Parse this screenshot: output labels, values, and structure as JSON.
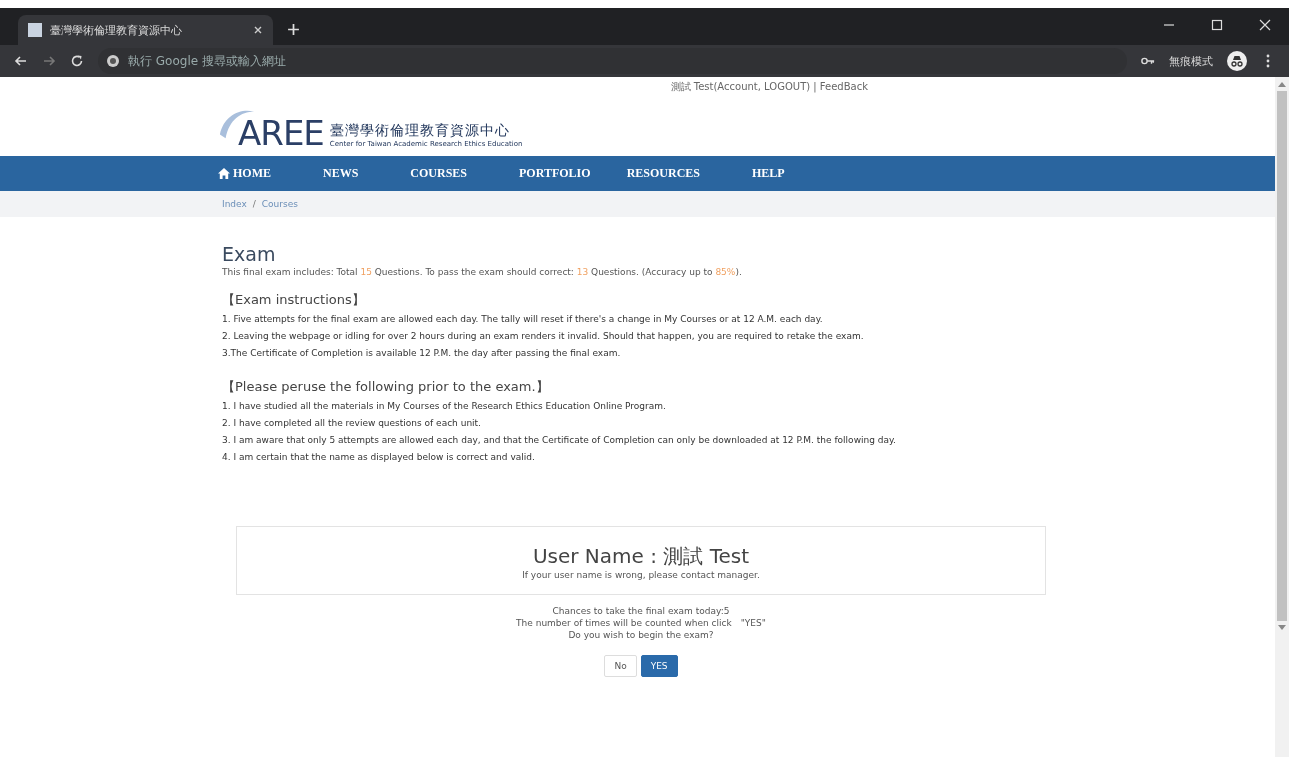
{
  "browser": {
    "tab_title": "臺灣學術倫理教育資源中心",
    "address_placeholder": "執行 Google 搜尋或輸入網址",
    "profile_label": "無痕模式"
  },
  "header": {
    "account_line": "測試 Test(Account, LOGOUT) | FeedBack",
    "logo_text": "AREE",
    "site_name": "臺灣學術倫理教育資源中心",
    "site_subtitle": "Center for Taiwan Academic Research Ethics Education"
  },
  "nav": [
    {
      "label": "HOME",
      "kind": "home"
    },
    {
      "label": "NEWS",
      "kind": "plain"
    },
    {
      "label": "COURSES",
      "kind": "plain"
    },
    {
      "label": "PORTFOLIO",
      "kind": "plain"
    },
    {
      "label": "RESOURCES",
      "kind": "plain"
    },
    {
      "label": "HELP",
      "kind": "plain"
    }
  ],
  "breadcrumb": [
    "Index",
    "Courses"
  ],
  "breadcrumb_separator": "/",
  "exam": {
    "title": "Exam",
    "intro": [
      {
        "text": "This final exam includes: Total ",
        "highlight": false
      },
      {
        "text": "15",
        "highlight": true
      },
      {
        "text": " Questions. To pass the exam should correct: ",
        "highlight": false
      },
      {
        "text": "13",
        "highlight": true
      },
      {
        "text": " Questions. (Accuracy up to ",
        "highlight": false
      },
      {
        "text": "85%",
        "highlight": true
      },
      {
        "text": ").",
        "highlight": false
      }
    ],
    "instructions_heading": "【Exam instructions】",
    "instructions": [
      "1. Five attempts for the final exam are allowed each day. The tally will reset if there's a change in My Courses or at 12 A.M. each day.",
      "2. Leaving the webpage or idling for over 2 hours during an exam renders it invalid. Should that happen, you are required to retake the exam.",
      "3.The Certificate of Completion is available 12 P.M. the day after passing the final exam."
    ],
    "peruse_heading": "【Please peruse the following prior to the exam.】",
    "peruse": [
      "1. I have studied all the materials in My Courses of the Research Ethics Education Online Program.",
      "2. I have completed all the review questions of each unit.",
      "3. I am aware that only 5 attempts are allowed each day, and that the Certificate of Completion can only be downloaded at 12 P.M. the following day.",
      "4. I am certain that the name as displayed below is correct and valid."
    ],
    "user_name": "User Name : 測試 Test",
    "user_hint": "If your user name is wrong, please contact manager.",
    "notes": [
      "Chances to take the final exam today:5",
      "The number of times will be counted when click　\"YES\"",
      "Do you wish to begin the exam?"
    ],
    "buttons": [
      {
        "label": "No",
        "kind": "default"
      },
      {
        "label": "YES",
        "kind": "primary"
      }
    ]
  }
}
